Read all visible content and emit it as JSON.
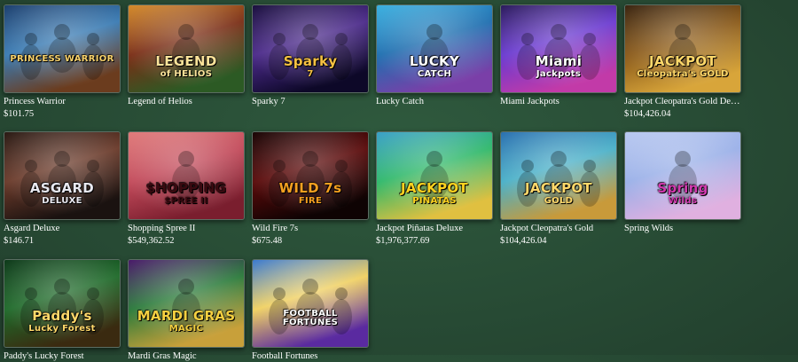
{
  "games": [
    {
      "title": "Princess Warrior",
      "jackpot": "$101.75",
      "logo": "PRINCESS WARRIOR",
      "logo_sub": "",
      "bg": [
        "#1c3f6e",
        "#3a7bb3",
        "#6b3c1e"
      ],
      "logo_color": "#f7d16a"
    },
    {
      "title": "Legend of Helios",
      "jackpot": "",
      "logo": "LEGEND",
      "logo_sub": "of HELIOS",
      "bg": [
        "#d48a2a",
        "#7a2e16",
        "#2c5a24"
      ],
      "logo_color": "#fbe39a"
    },
    {
      "title": "Sparky 7",
      "jackpot": "",
      "logo": "Sparky",
      "logo_sub": "7",
      "bg": [
        "#1a0f3e",
        "#4b2a8a",
        "#0d0828"
      ],
      "logo_color": "#f5c142"
    },
    {
      "title": "Lucky Catch",
      "jackpot": "",
      "logo": "LUCKY",
      "logo_sub": "CATCH",
      "bg": [
        "#3ab0e0",
        "#1f6fb0",
        "#7a3fa8"
      ],
      "logo_color": "#ffffff"
    },
    {
      "title": "Miami Jackpots",
      "jackpot": "",
      "logo": "Miami",
      "logo_sub": "Jackpots",
      "bg": [
        "#2b1b5c",
        "#6a3ad0",
        "#c23aa8"
      ],
      "logo_color": "#ffffff"
    },
    {
      "title": "Jackpot Cleopatra's Gold Deluxe",
      "jackpot": "$104,426.04",
      "logo": "JACKPOT",
      "logo_sub": "Cleopatra's GOLD",
      "bg": [
        "#3a2410",
        "#8a5a1a",
        "#d8a53a"
      ],
      "logo_color": "#ffd86a"
    },
    {
      "title": "Asgard Deluxe",
      "jackpot": "$146.71",
      "logo": "ASGARD",
      "logo_sub": "DELUXE",
      "bg": [
        "#2a1a14",
        "#6a3a2a",
        "#1a1210"
      ],
      "logo_color": "#e8e8f0"
    },
    {
      "title": "Shopping Spree II",
      "jackpot": "$549,362.52",
      "logo": "$HOPPING",
      "logo_sub": "$PREE II",
      "bg": [
        "#e07a7a",
        "#c24a5a",
        "#7a1e2e"
      ],
      "logo_color": "#3a0a10"
    },
    {
      "title": "Wild Fire 7s",
      "jackpot": "$675.48",
      "logo": "WILD 7s",
      "logo_sub": "FIRE",
      "bg": [
        "#1a0606",
        "#5a0a0a",
        "#0e0303"
      ],
      "logo_color": "#f5a020"
    },
    {
      "title": "Jackpot Piñatas Deluxe",
      "jackpot": "$1,976,377.69",
      "logo": "JACKPOT",
      "logo_sub": "PIÑATAS",
      "bg": [
        "#3aa0c8",
        "#2fb86a",
        "#e0c040"
      ],
      "logo_color": "#ffd21e"
    },
    {
      "title": "Jackpot Cleopatra's Gold",
      "jackpot": "$104,426.04",
      "logo": "JACKPOT",
      "logo_sub": "GOLD",
      "bg": [
        "#2a70b0",
        "#4ab0c8",
        "#c89a3a"
      ],
      "logo_color": "#ffd86a"
    },
    {
      "title": "Spring Wilds",
      "jackpot": "",
      "logo": "Spring",
      "logo_sub": "Wilds",
      "bg": [
        "#b8c8f0",
        "#9ab0e8",
        "#e0b0e0"
      ],
      "logo_color": "#d23ab0"
    },
    {
      "title": "Paddy's Lucky Forest",
      "jackpot": "",
      "logo": "Paddy's",
      "logo_sub": "Lucky Forest",
      "bg": [
        "#0e3a1a",
        "#1f6a2a",
        "#3a2a10"
      ],
      "logo_color": "#ffd86a"
    },
    {
      "title": "Mardi Gras Magic",
      "jackpot": "",
      "logo": "MARDI GRAS",
      "logo_sub": "MAGIC",
      "bg": [
        "#4a1a6a",
        "#2a7a3a",
        "#c8a03a"
      ],
      "logo_color": "#f5d040"
    },
    {
      "title": "Football Fortunes",
      "jackpot": "",
      "logo": "FOOTBALL FORTUNES",
      "logo_sub": "",
      "bg": [
        "#3a7ad0",
        "#f0d060",
        "#5a2aa0"
      ],
      "logo_color": "#ffffff"
    }
  ]
}
